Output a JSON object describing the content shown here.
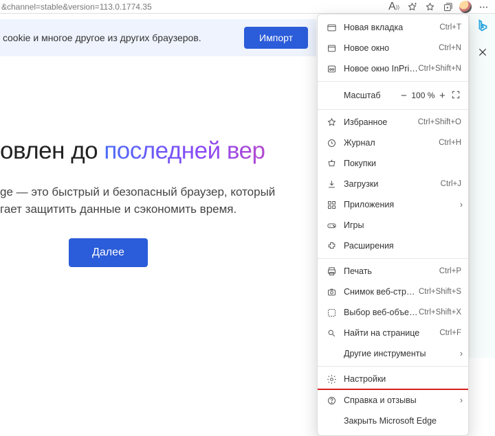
{
  "address_fragment": "&channel=stable&version=113.0.1774.35",
  "banner": {
    "text": " cookie и многое другое из других браузеров.",
    "import_label": "Импорт"
  },
  "main": {
    "headline_plain": "овлен до ",
    "headline_grad": "последней вер",
    "sub1": "ge — это быстрый и безопасный браузер, который",
    "sub2": "гает защитить данные и сэкономить время.",
    "next_label": "Далее"
  },
  "zoom": {
    "label": "Масштаб",
    "value": "100 %"
  },
  "menu": {
    "new_tab": {
      "label": "Новая вкладка",
      "shortcut": "Ctrl+T"
    },
    "new_window": {
      "label": "Новое окно",
      "shortcut": "Ctrl+N"
    },
    "new_inprivate": {
      "label": "Новое окно InPrivate",
      "shortcut": "Ctrl+Shift+N"
    },
    "favorites": {
      "label": "Избранное",
      "shortcut": "Ctrl+Shift+O"
    },
    "history": {
      "label": "Журнал",
      "shortcut": "Ctrl+H"
    },
    "shopping": {
      "label": "Покупки",
      "shortcut": ""
    },
    "downloads": {
      "label": "Загрузки",
      "shortcut": "Ctrl+J"
    },
    "apps": {
      "label": "Приложения",
      "shortcut": ""
    },
    "games": {
      "label": "Игры",
      "shortcut": ""
    },
    "extensions": {
      "label": "Расширения",
      "shortcut": ""
    },
    "print": {
      "label": "Печать",
      "shortcut": "Ctrl+P"
    },
    "webcapture": {
      "label": "Снимок веб-страницы",
      "shortcut": "Ctrl+Shift+S"
    },
    "webselect": {
      "label": "Выбор веб-объектов",
      "shortcut": "Ctrl+Shift+X"
    },
    "find": {
      "label": "Найти на странице",
      "shortcut": "Ctrl+F"
    },
    "moretools": {
      "label": "Другие инструменты",
      "shortcut": ""
    },
    "settings": {
      "label": "Настройки",
      "shortcut": ""
    },
    "help": {
      "label": "Справка и отзывы",
      "shortcut": ""
    },
    "close_edge": {
      "label": "Закрыть Microsoft Edge",
      "shortcut": ""
    }
  }
}
